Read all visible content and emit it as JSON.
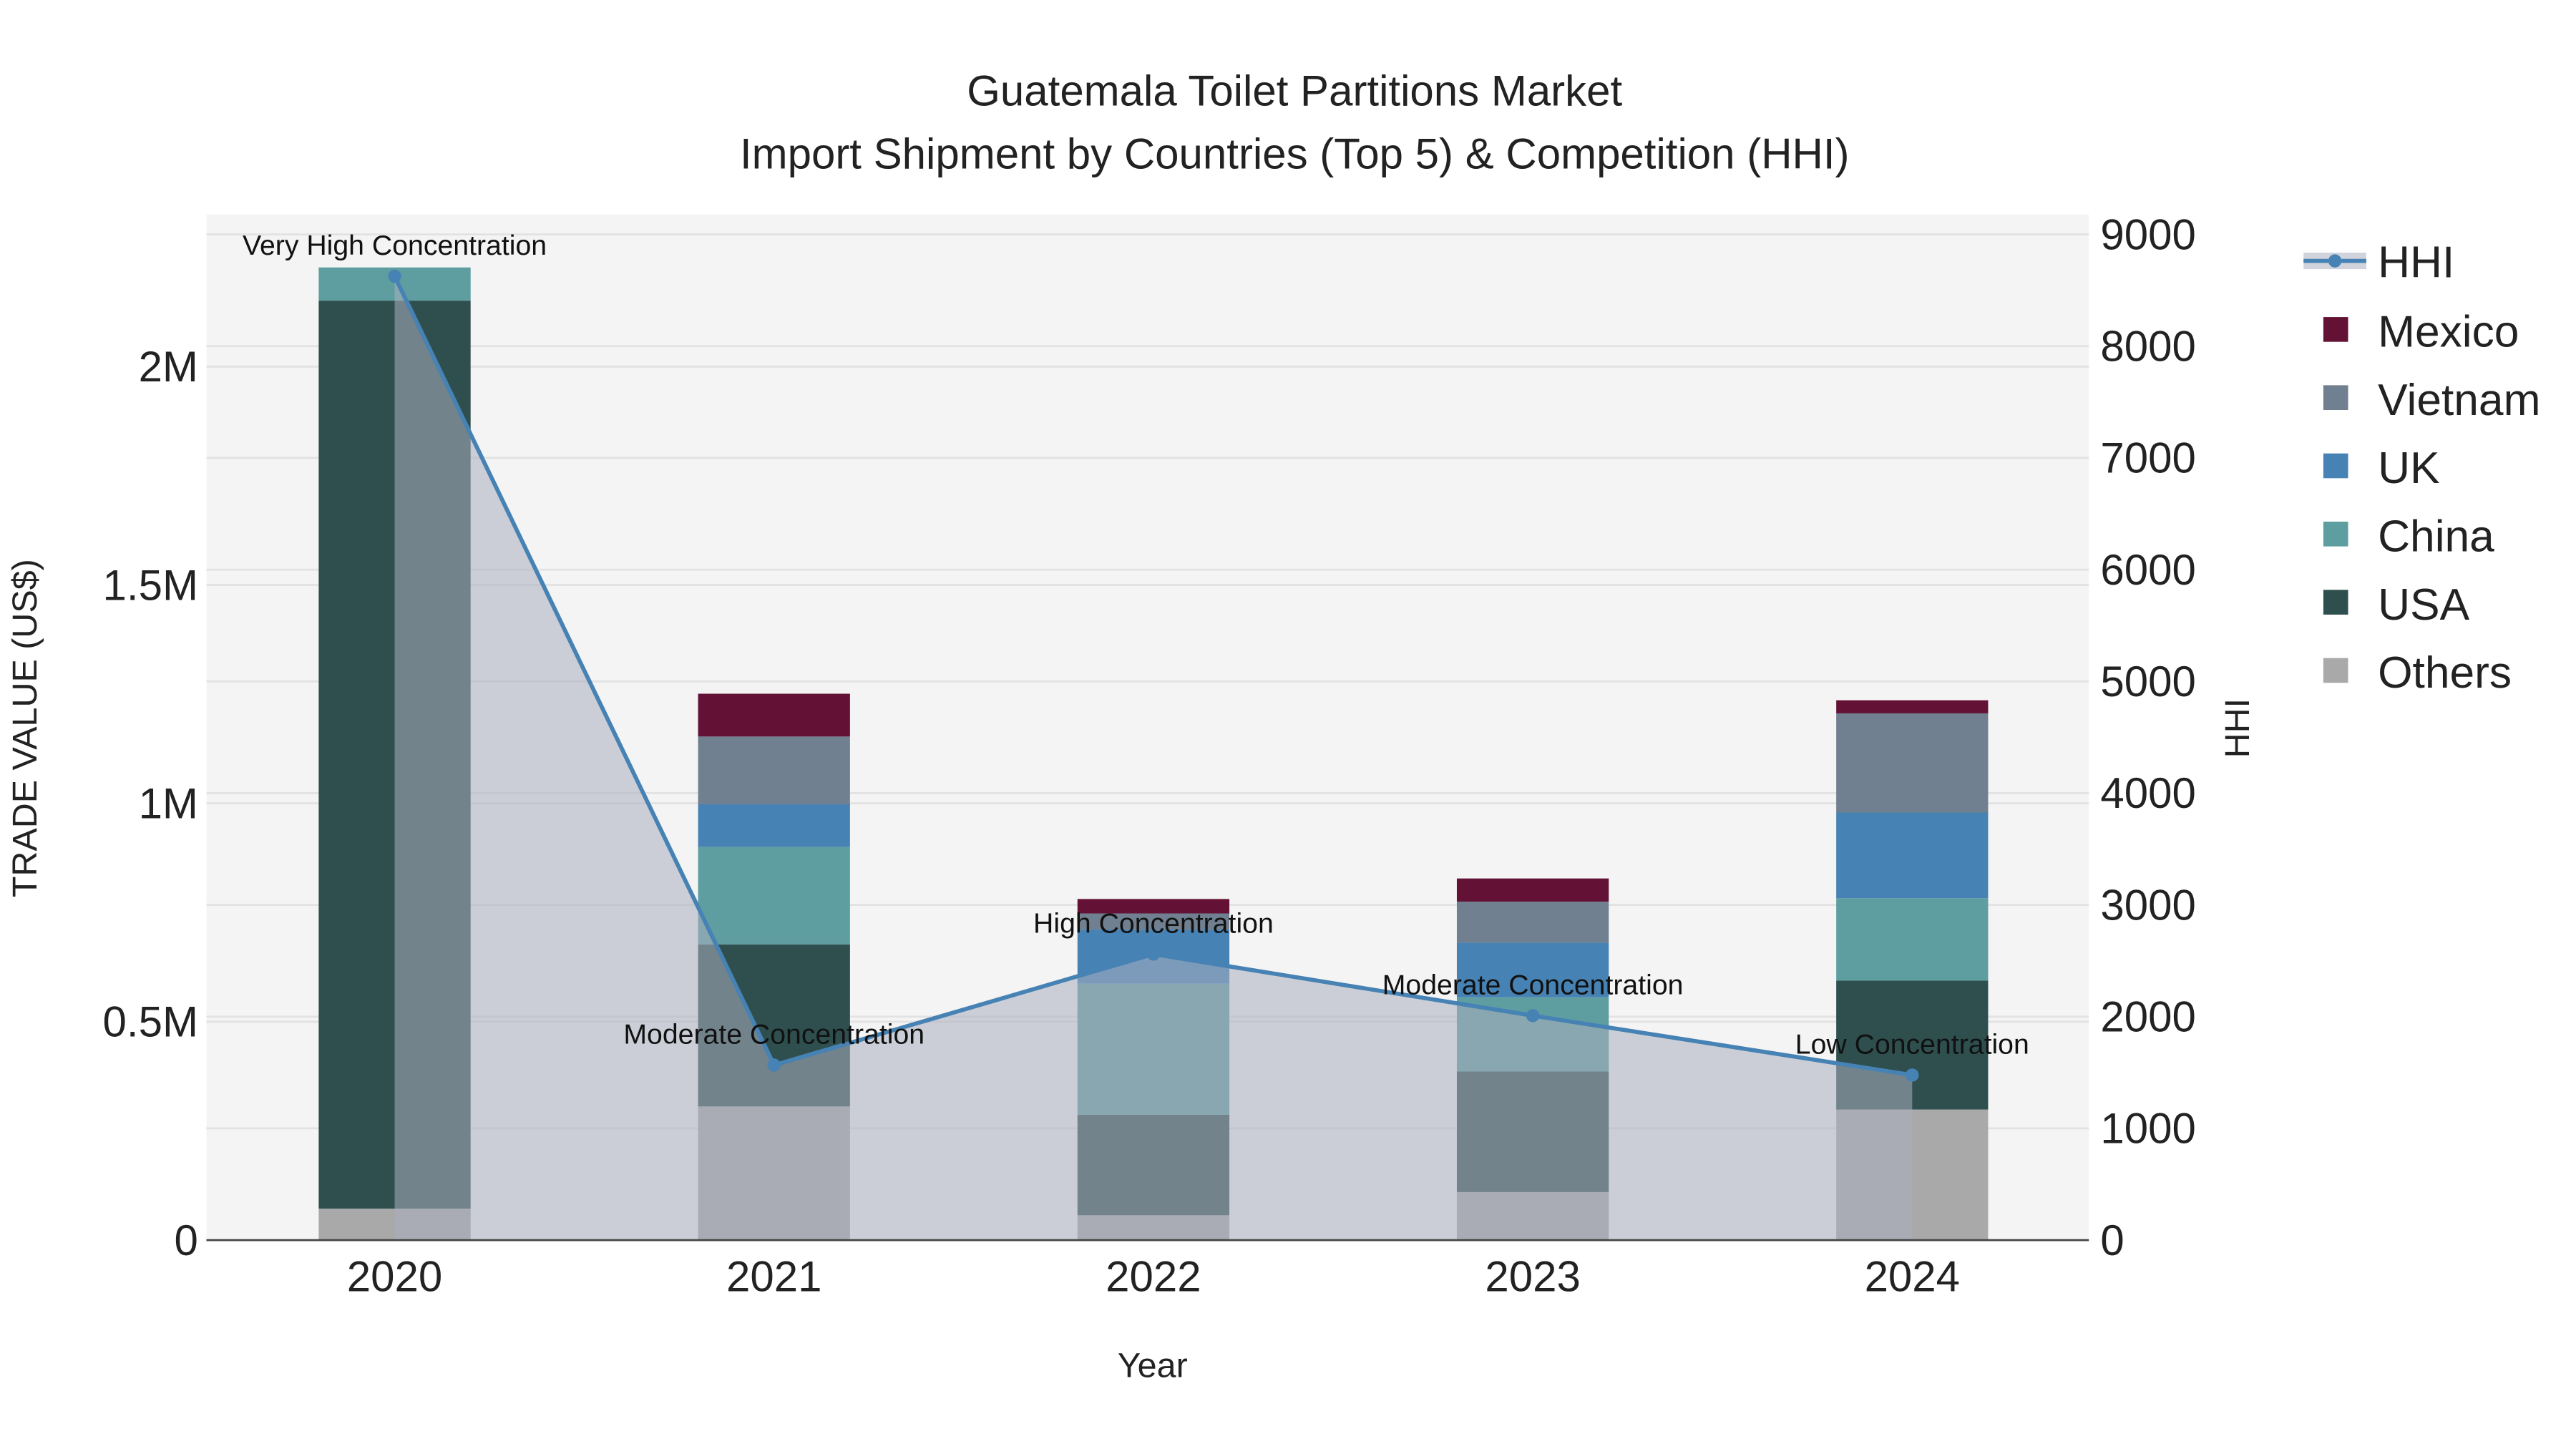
{
  "chart_data": {
    "type": "bar",
    "title": "Guatemala Toilet Partitions Market",
    "subtitle": "Import Shipment by Countries (Top 5) & Competition (HHI)",
    "xlabel": "Year",
    "ylabel": "TRADE VALUE (US$)",
    "y2label": "HHI",
    "categories": [
      "2020",
      "2021",
      "2022",
      "2023",
      "2024"
    ],
    "ylim": [
      0,
      2300000
    ],
    "y2lim": [
      0,
      9180
    ],
    "yticks": [
      {
        "v": 0,
        "label": "0"
      },
      {
        "v": 500000,
        "label": "0.5M"
      },
      {
        "v": 1000000,
        "label": "1M"
      },
      {
        "v": 1500000,
        "label": "1.5M"
      },
      {
        "v": 2000000,
        "label": "2M"
      }
    ],
    "y2ticks": [
      0,
      1000,
      2000,
      3000,
      4000,
      5000,
      6000,
      7000,
      8000,
      9000
    ],
    "series": [
      {
        "name": "Others",
        "color": "#a9a9a9",
        "values": [
          72000,
          306000,
          57000,
          110000,
          299000
        ]
      },
      {
        "name": "USA",
        "color": "#2f4f4f",
        "values": [
          2079000,
          371000,
          230000,
          276000,
          295000
        ]
      },
      {
        "name": "China",
        "color": "#5f9ea0",
        "values": [
          76000,
          223000,
          300000,
          170000,
          189000
        ]
      },
      {
        "name": "UK",
        "color": "#4682b4",
        "values": [
          0,
          98000,
          124000,
          125000,
          196000
        ]
      },
      {
        "name": "Vietnam",
        "color": "#708090",
        "values": [
          0,
          155000,
          37000,
          94000,
          227000
        ]
      },
      {
        "name": "Mexico",
        "color": "#631235",
        "values": [
          0,
          98000,
          33000,
          53000,
          30000
        ]
      }
    ],
    "hhi": {
      "name": "HHI",
      "color": "#4682b4",
      "values": [
        8626,
        1566,
        2560,
        2009,
        1477
      ],
      "annotations": [
        "Very High Concentration",
        "Moderate Concentration",
        "High Concentration",
        "Moderate Concentration",
        "Low Concentration"
      ]
    },
    "legend": {
      "placement": "right",
      "order": [
        "HHI",
        "Mexico",
        "Vietnam",
        "UK",
        "China",
        "USA",
        "Others"
      ]
    }
  }
}
